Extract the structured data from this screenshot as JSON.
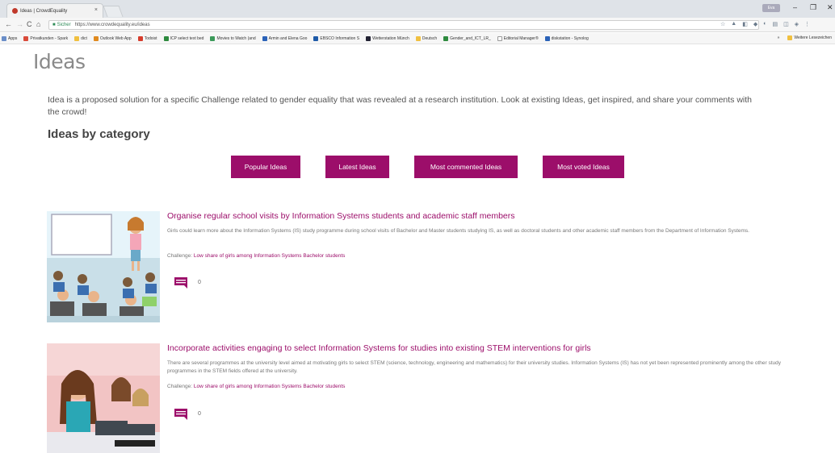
{
  "browser": {
    "tab_title": "Ideas | CrowdEquality",
    "tab_close": "×",
    "user_chip": "Eva",
    "url_secure": "Sicher",
    "url": "https://www.crowdequality.eu/ideas",
    "bookmarks": [
      "Apps",
      "Privatkunden - Spark",
      "dict",
      "Outlook Web App",
      "Todoist",
      "ICP select text bed",
      "Movies to Watch (and",
      "Armin and Elena Goo",
      "EBSCO Information S",
      "Wetterstation Münch",
      "Deutsch",
      "Gender_and_ICT_LR_",
      "Editorial Manager®",
      "diskstation - Synolog"
    ],
    "bookmarks_more": "»",
    "bookmarks_other": "Weitere Lesezeichen"
  },
  "page": {
    "title": "Ideas",
    "intro": "Idea is a proposed solution for a specific Challenge related to gender equality that was revealed at a research institution. Look at existing Ideas, get inspired, and share your comments with the crowd!",
    "section_title": "Ideas by category"
  },
  "filters": [
    "Popular Ideas",
    "Latest Ideas",
    "Most commented Ideas",
    "Most voted Ideas"
  ],
  "ideas": [
    {
      "title": "Organise regular school visits by Information Systems students and academic staff members",
      "description": "Girls could learn more about the Information Systems (IS) study programme during school visits of Bachelor and Master students studying IS, as well as doctoral students and other academic staff members from the Department of Information Systems.",
      "challenge_label": "Challenge:",
      "challenge_link": "Low share of girls among Information Systems Bachelor students",
      "comments": "0"
    },
    {
      "title": "Incorporate activities engaging to select Information Systems for studies into existing STEM interventions for girls",
      "description": "There are several programmes at the university level aimed at motivating girls to select STEM (science, technology, engineering and mathematics) for their university studies. Information Systems (IS) has not yet been represented prominently among the other study programmes in the STEM fields offered at the university.",
      "challenge_label": "Challenge:",
      "challenge_link": "Low share of girls among Information Systems Bachelor students",
      "comments": "0"
    }
  ],
  "colors": {
    "accent": "#9c0e6a",
    "title_gray": "#8a8a8a"
  }
}
